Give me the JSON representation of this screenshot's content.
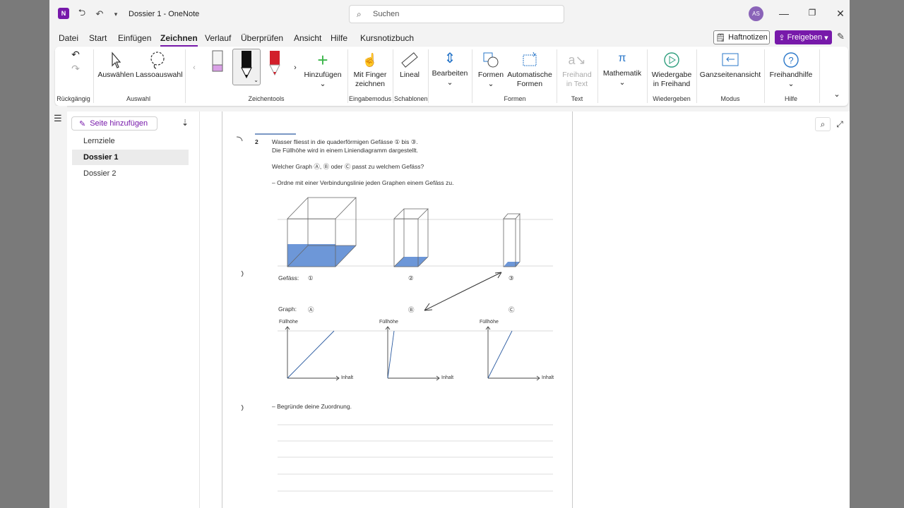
{
  "titlebar": {
    "doc_title": "Dossier 1  -  OneNote",
    "search_placeholder": "Suchen",
    "avatar": "AS"
  },
  "menu": [
    "Datei",
    "Start",
    "Einfügen",
    "Zeichnen",
    "Verlauf",
    "Überprüfen",
    "Ansicht",
    "Hilfe",
    "Kursnotizbuch"
  ],
  "active_menu": "Zeichnen",
  "buttons": {
    "sticky": "Haftnotizen",
    "share": "Freigeben"
  },
  "ribbon": {
    "select": "Auswählen",
    "lasso": "Lassoauswahl",
    "add": "Hinzufügen",
    "finger": "Mit Finger zeichnen",
    "ruler": "Lineal",
    "edit": "Bearbeiten",
    "shapes": "Formen",
    "auto_shapes": "Automatische Formen",
    "ink_text": "Freihand in Text",
    "math": "Mathematik",
    "replay": "Wiedergabe in Freihand",
    "fullpage": "Ganzseitenansicht",
    "help": "Freihandhilfe",
    "groups": {
      "undo": "Rückgängig",
      "select": "Auswahl",
      "tools": "Zeichentools",
      "input": "Eingabemodus",
      "templates": "Schablonen",
      "shapes": "Formen",
      "text": "Text",
      "replay": "Wiedergeben",
      "mode": "Modus",
      "help": "Hilfe"
    }
  },
  "pages": {
    "add": "Seite hinzufügen",
    "items": [
      "Lernziele",
      "Dossier 1",
      "Dossier 2"
    ],
    "selected": "Dossier 1"
  },
  "worksheet": {
    "number": "2",
    "line1": "Wasser fliesst in die quaderförmigen Gefässe ① bis ③.",
    "line2": "Die Füllhöhe wird in einem Liniendiagramm dargestellt.",
    "question": "Welcher Graph Ⓐ, Ⓑ oder Ⓒ passt zu welchem Gefäss?",
    "task1": "–  Ordne mit einer Verbindungslinie jeden Graphen einem Gefäss zu.",
    "vessel_label": "Gefäss:",
    "vessels": [
      "①",
      "②",
      "③"
    ],
    "graph_label": "Graph:",
    "graphs": [
      "Ⓐ",
      "Ⓑ",
      "Ⓒ"
    ],
    "y_axis": "Füllhöhe",
    "x_axis": "Inhalt",
    "task2": "–  Begründe deine Zuordnung."
  },
  "colors": {
    "accent": "#7719aa",
    "water": "#6d97d8"
  }
}
